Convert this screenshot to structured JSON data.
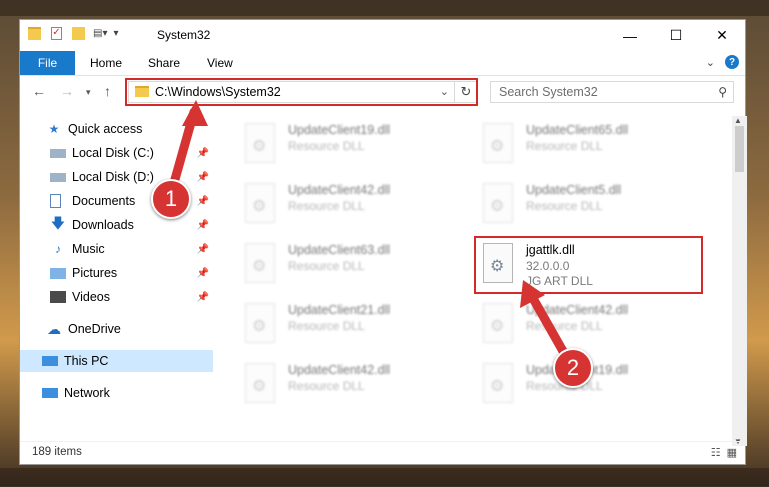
{
  "window": {
    "title": "System32",
    "qa_icons": [
      "folder-icon",
      "properties-icon",
      "new-folder-icon",
      "customize-icon"
    ]
  },
  "ribbon": {
    "tabs": [
      "File",
      "Home",
      "Share",
      "View"
    ],
    "help": "?"
  },
  "navbar": {
    "address": "C:\\Windows\\System32",
    "search_placeholder": "Search System32"
  },
  "sidebar": {
    "items": [
      {
        "label": "Quick access",
        "icon": "star-icon",
        "pinned": false
      },
      {
        "label": "Local Disk (C:)",
        "icon": "drive-icon",
        "pinned": true
      },
      {
        "label": "Local Disk (D:)",
        "icon": "drive-icon",
        "pinned": true
      },
      {
        "label": "Documents",
        "icon": "documents-icon",
        "pinned": true
      },
      {
        "label": "Downloads",
        "icon": "downloads-icon",
        "pinned": true
      },
      {
        "label": "Music",
        "icon": "music-icon",
        "pinned": true
      },
      {
        "label": "Pictures",
        "icon": "pictures-icon",
        "pinned": true
      },
      {
        "label": "Videos",
        "icon": "videos-icon",
        "pinned": true
      },
      {
        "label": "OneDrive",
        "icon": "onedrive-icon",
        "pinned": false
      },
      {
        "label": "This PC",
        "icon": "pc-icon",
        "pinned": false,
        "selected": true
      },
      {
        "label": "Network",
        "icon": "network-icon",
        "pinned": false
      }
    ]
  },
  "files": [
    {
      "name": "UpdateClient19.dll",
      "type": "Resource DLL"
    },
    {
      "name": "UpdateClient65.dll",
      "type": "Resource DLL"
    },
    {
      "name": "UpdateClient42.dll",
      "type": "Resource DLL"
    },
    {
      "name": "UpdateClient5.dll",
      "type": "Resource DLL"
    },
    {
      "name": "UpdateClient63.dll",
      "type": "Resource DLL"
    },
    {
      "name": "jgattlk.dll",
      "version": "32.0.0.0",
      "description": "JG ART DLL",
      "highlighted": true
    },
    {
      "name": "UpdateClient21.dll",
      "type": "Resource DLL"
    },
    {
      "name": "UpdateClient42.dll",
      "type": "Resource DLL"
    },
    {
      "name": "UpdateClient42.dll",
      "type": "Resource DLL"
    },
    {
      "name": "UpdateClient19.dll",
      "type": "Resource DLL"
    }
  ],
  "status": {
    "count": "189 items"
  },
  "annotations": {
    "step1": "1",
    "step2": "2"
  },
  "colors": {
    "accent": "#1979ca",
    "highlight_box": "#d42a2a",
    "selected": "#cde8ff"
  }
}
